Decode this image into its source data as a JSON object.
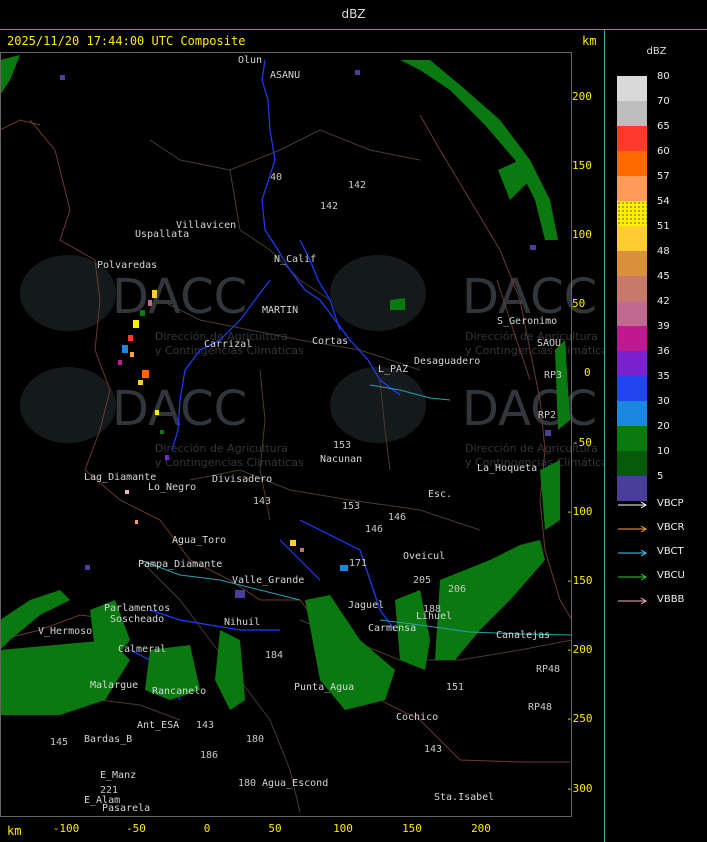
{
  "header": {
    "title": "dBZ",
    "timestamp": "2025/11/20 17:44:00 UTC Composite",
    "km_top": "km",
    "km_bottom": "km"
  },
  "axes": {
    "y_ticks": [
      "200",
      "150",
      "100",
      "50",
      "0",
      "-50",
      "-100",
      "-150",
      "-200",
      "-250",
      "-300"
    ],
    "x_ticks": [
      "-100",
      "-50",
      "0",
      "50",
      "100",
      "150",
      "200"
    ]
  },
  "legend": {
    "unit": "dBZ",
    "levels": [
      {
        "label": "80",
        "color": "#d9d9d9"
      },
      {
        "label": "70",
        "color": "#bdbdbd"
      },
      {
        "label": "65",
        "color": "#ff3a2a"
      },
      {
        "label": "60",
        "color": "#ff6a00"
      },
      {
        "label": "57",
        "color": "#ff9a5a"
      },
      {
        "label": "54",
        "color": "#ffee00"
      },
      {
        "label": "51",
        "color": "#ffcc33"
      },
      {
        "label": "48",
        "color": "#d9903a"
      },
      {
        "label": "45",
        "color": "#c87a6a"
      },
      {
        "label": "42",
        "color": "#c06a90"
      },
      {
        "label": "39",
        "color": "#c01890"
      },
      {
        "label": "36",
        "color": "#7a22d0"
      },
      {
        "label": "35",
        "color": "#2244ee"
      },
      {
        "label": "30",
        "color": "#1a88e0"
      },
      {
        "label": "20",
        "color": "#0a7a10"
      },
      {
        "label": "10",
        "color": "#075a0a"
      },
      {
        "label": "5",
        "color": "#4a3e9a"
      }
    ],
    "radars": [
      {
        "name": "VBCP",
        "color": "#ffffff"
      },
      {
        "name": "VBCR",
        "color": "#ffa040"
      },
      {
        "name": "VBCT",
        "color": "#40d0ff"
      },
      {
        "name": "VBCU",
        "color": "#30d030"
      },
      {
        "name": "VBBB",
        "color": "#ffb0c0"
      }
    ]
  },
  "watermark": {
    "name": "DACC",
    "line1": "Dirección de Agricultura",
    "line2": "y Contingencias Climáticas"
  },
  "places": [
    {
      "name": "Olun"
    },
    {
      "name": "ASANU"
    },
    {
      "name": "Villavicen"
    },
    {
      "name": "Uspallata"
    },
    {
      "name": "Polvaredas"
    },
    {
      "name": "N_Calif"
    },
    {
      "name": "MARTIN"
    },
    {
      "name": "Carrizal"
    },
    {
      "name": "Cortas"
    },
    {
      "name": "L_PAZ"
    },
    {
      "name": "Desaguadero"
    },
    {
      "name": "S_Geronimo"
    },
    {
      "name": "SAOU"
    },
    {
      "name": "Nacunan"
    },
    {
      "name": "Lag_Diamante"
    },
    {
      "name": "Lo_Negro"
    },
    {
      "name": "Divisadero"
    },
    {
      "name": "Esc."
    },
    {
      "name": "Agua_Toro"
    },
    {
      "name": "Pampa_Diamante"
    },
    {
      "name": "Valle_Grande"
    },
    {
      "name": "Parlamentos"
    },
    {
      "name": "Soscheado"
    },
    {
      "name": "V_Hermoso"
    },
    {
      "name": "Carmensa"
    },
    {
      "name": "Lihuel"
    },
    {
      "name": "Canalejas"
    },
    {
      "name": "Oveicul"
    },
    {
      "name": "Punta_Agua"
    },
    {
      "name": "Cochico"
    },
    {
      "name": "Bardas_B"
    },
    {
      "name": "Ant_ESA"
    },
    {
      "name": "E_Manz"
    },
    {
      "name": "E_Alam"
    },
    {
      "name": "Pasarela"
    },
    {
      "name": "Agua_Escond"
    },
    {
      "name": "Sta.Isabel"
    },
    {
      "name": "La_Hoqueta"
    },
    {
      "name": "Nihuil"
    },
    {
      "name": "Calmeral"
    },
    {
      "name": "Jaguel"
    },
    {
      "name": "Rancanelo"
    },
    {
      "name": "Malargue"
    }
  ],
  "routes": [
    {
      "label": "40"
    },
    {
      "label": "142"
    },
    {
      "label": "142"
    },
    {
      "label": "153"
    },
    {
      "label": "143"
    },
    {
      "label": "153"
    },
    {
      "label": "146"
    },
    {
      "label": "146"
    },
    {
      "label": "171"
    },
    {
      "label": "205"
    },
    {
      "label": "206"
    },
    {
      "label": "188"
    },
    {
      "label": "151"
    },
    {
      "label": "184"
    },
    {
      "label": "180"
    },
    {
      "label": "180"
    },
    {
      "label": "186"
    },
    {
      "label": "143"
    },
    {
      "label": "143"
    },
    {
      "label": "145"
    },
    {
      "label": "221"
    },
    {
      "label": "RP3"
    },
    {
      "label": "RP48"
    },
    {
      "label": "RP48"
    },
    {
      "label": "RP2"
    }
  ]
}
